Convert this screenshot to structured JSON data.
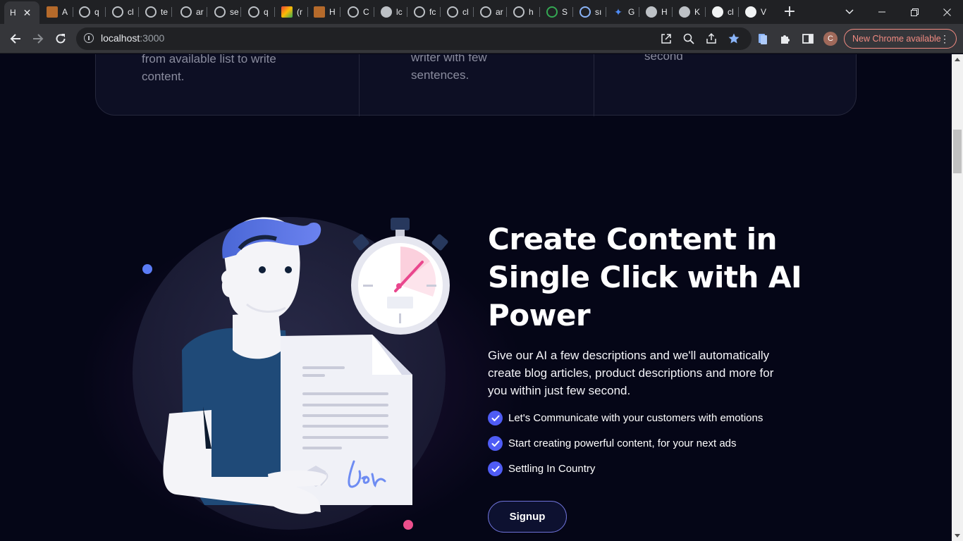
{
  "browser": {
    "tabs": [
      {
        "label": "H",
        "icon": "page-icon"
      },
      {
        "label": "A",
        "icon": "book-icon"
      },
      {
        "label": "q",
        "icon": "openai-icon"
      },
      {
        "label": "cl",
        "icon": "openai-icon"
      },
      {
        "label": "te",
        "icon": "openai-icon"
      },
      {
        "label": "ar",
        "icon": "openai-icon"
      },
      {
        "label": "se",
        "icon": "openai-icon"
      },
      {
        "label": "q",
        "icon": "openai-icon"
      },
      {
        "label": "(r",
        "icon": "gmail-icon"
      },
      {
        "label": "H",
        "icon": "book-icon"
      },
      {
        "label": "C",
        "icon": "openai-icon"
      },
      {
        "label": "lc",
        "icon": "globe-icon"
      },
      {
        "label": "fc",
        "icon": "openai-icon"
      },
      {
        "label": "cl",
        "icon": "openai-icon"
      },
      {
        "label": "ar",
        "icon": "openai-icon"
      },
      {
        "label": "h",
        "icon": "openai-icon"
      },
      {
        "label": "S",
        "icon": "green-icon"
      },
      {
        "label": "sı",
        "icon": "wordpress-icon"
      },
      {
        "label": "G",
        "icon": "gemini-icon"
      },
      {
        "label": "H",
        "icon": "globe-icon"
      },
      {
        "label": "K",
        "icon": "globe-icon"
      },
      {
        "label": "cl",
        "icon": "github-icon"
      },
      {
        "label": "V",
        "icon": "vercel-icon"
      }
    ],
    "url_host": "localhost",
    "url_port": ":3000",
    "avatar_letter": "C",
    "update_label": "New Chrome available",
    "menu_glyph": "⋮",
    "close_glyph": "✕",
    "newtab_glyph": "+"
  },
  "features": [
    {
      "text_lines": [
        "from available list to write",
        "content."
      ]
    },
    {
      "text_lines": [
        "writer with few",
        "sentences."
      ]
    },
    {
      "text_lines": [
        "second"
      ]
    }
  ],
  "hero": {
    "title_lines": [
      "Create Content in",
      "Single Click with AI",
      "Power"
    ],
    "description_lines": [
      "Give our AI a few descriptions and we'll automatically",
      "create blog articles, product descriptions and more for",
      "you within just few second."
    ],
    "checklist": [
      "Let's Communicate with your customers with emotions",
      "Start creating powerful content, for your next ads",
      "Settling In Country"
    ],
    "signup_label": "Signup"
  },
  "colors": {
    "page_bg": "#050617",
    "accent": "#4f5cf5",
    "dot_blue": "#5b7cf6",
    "dot_pink": "#ec4f8c"
  }
}
